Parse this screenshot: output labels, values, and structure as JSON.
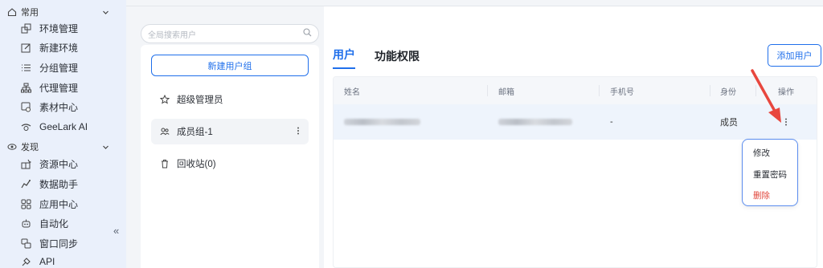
{
  "sidebar": {
    "sections": [
      {
        "label": "常用",
        "icon": "home-icon"
      },
      {
        "label": "发现",
        "icon": "eye-icon"
      }
    ],
    "items": [
      {
        "label": "环境管理",
        "icon": "environment-icon"
      },
      {
        "label": "新建环境",
        "icon": "edit-icon"
      },
      {
        "label": "分组管理",
        "icon": "list-icon"
      },
      {
        "label": "代理管理",
        "icon": "proxy-icon"
      },
      {
        "label": "素材中心",
        "icon": "materials-icon"
      },
      {
        "label": "GeeLark AI",
        "icon": "ai-icon"
      },
      {
        "label": "资源中心",
        "icon": "resources-icon"
      },
      {
        "label": "数据助手",
        "icon": "data-icon"
      },
      {
        "label": "应用中心",
        "icon": "apps-icon"
      },
      {
        "label": "自动化",
        "icon": "robot-icon"
      },
      {
        "label": "窗口同步",
        "icon": "sync-icon"
      },
      {
        "label": "API",
        "icon": "api-icon"
      }
    ],
    "collapse": "«"
  },
  "groups": {
    "search_placeholder": "全局搜索用户",
    "new_group_label": "新建用户组",
    "items": [
      {
        "label": "超级管理员",
        "icon": "star-icon"
      },
      {
        "label": "成员组-1",
        "icon": "users-icon",
        "active": true
      },
      {
        "label": "回收站(0)",
        "icon": "trash-icon"
      }
    ]
  },
  "main": {
    "tabs": [
      {
        "label": "用户",
        "active": true
      },
      {
        "label": "功能权限",
        "active": false
      }
    ],
    "add_user_label": "添加用户",
    "table": {
      "columns": [
        "姓名",
        "邮箱",
        "手机号",
        "身份",
        "操作"
      ],
      "rows": [
        {
          "name": "",
          "email": "",
          "phone": "-",
          "role": "成员"
        }
      ]
    },
    "row_menu": [
      "修改",
      "重置密码",
      "删除"
    ]
  },
  "colors": {
    "accent": "#1f6feb",
    "danger": "#e0453a",
    "arrow": "#e8473e"
  }
}
